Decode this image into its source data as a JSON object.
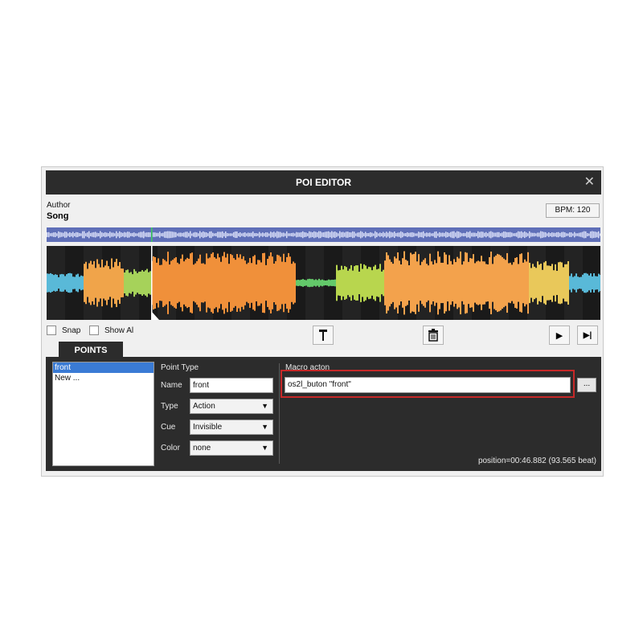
{
  "window": {
    "title": "POI EDITOR",
    "close_glyph": "✕"
  },
  "track": {
    "author": "Author",
    "song": "Song",
    "bpm": "BPM: 120"
  },
  "options": {
    "snap_label": "Snap",
    "show_all_label": "Show Al"
  },
  "toolbar": {
    "marker_icon": "pin-marker-icon",
    "delete_icon": "trash-icon",
    "play_icon": "play-icon",
    "next_icon": "skip-next-icon",
    "play_glyph": "▶",
    "next_glyph": "▶|"
  },
  "tabs": {
    "points": "POINTS"
  },
  "points_list": {
    "items": [
      "front",
      "New ..."
    ],
    "selected_index": 0
  },
  "point_type": {
    "heading": "Point Type",
    "name_label": "Name",
    "name_value": "front",
    "type_label": "Type",
    "type_value": "Action",
    "cue_label": "Cue",
    "cue_value": "Invisible",
    "color_label": "Color",
    "color_value": "none"
  },
  "macro": {
    "label": "Macro acton",
    "value": "os2l_buton \"front\"",
    "browse_label": "..."
  },
  "status": {
    "position": "position=00:46.882 (93.565 beat)"
  },
  "colors": {
    "panel": "#2c2c2c",
    "highlight": "#c62828",
    "selection": "#3a7bd5",
    "overview": "#5f6fb8"
  }
}
